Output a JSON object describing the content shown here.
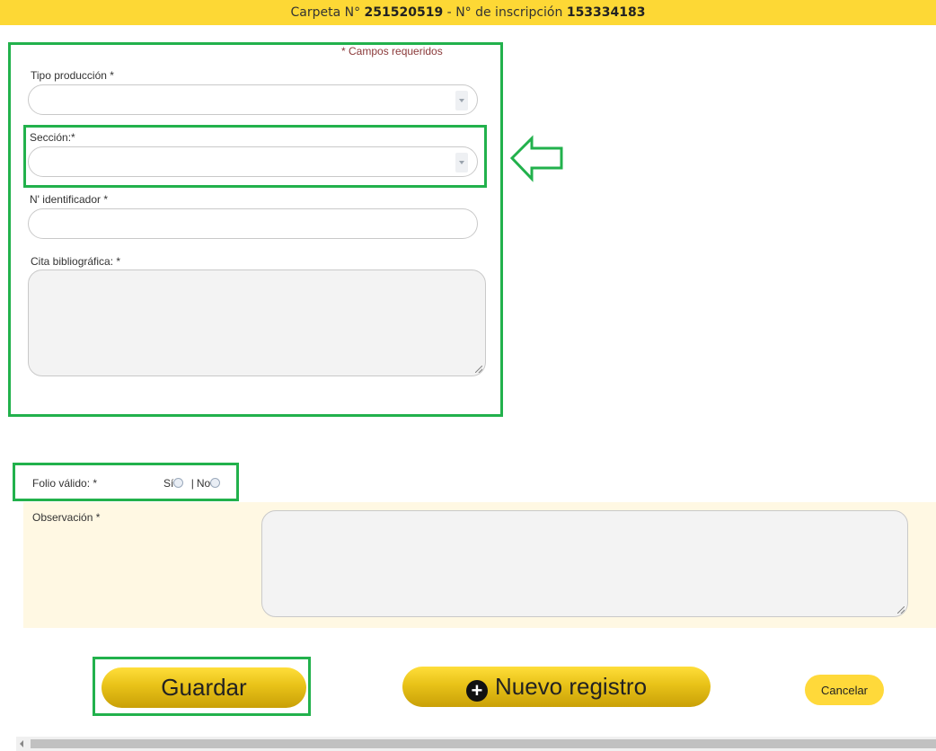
{
  "header": {
    "carpeta_label": "Carpeta N°",
    "carpeta_value": "251520519",
    "separator": "-",
    "inscripcion_label": "N° de inscripción",
    "inscripcion_value": "153334183"
  },
  "form": {
    "required_note": "* Campos requeridos",
    "tipo_produccion": {
      "label": "Tipo producción *",
      "value": ""
    },
    "seccion": {
      "label": "Sección:*",
      "value": ""
    },
    "identificador": {
      "label": "N' identificador *",
      "value": ""
    },
    "cita": {
      "label": "Cita bibliográfica: *",
      "value": ""
    }
  },
  "folio": {
    "label": "Folio válido: *",
    "yes_label": "Sí",
    "divider": "|",
    "no_label": "No"
  },
  "observacion": {
    "label": "Observación *",
    "value": ""
  },
  "actions": {
    "save_label": "Guardar",
    "new_label": "Nuevo registro",
    "cancel_label": "Cancelar"
  },
  "colors": {
    "accent_yellow": "#fdd835",
    "highlight_green": "#22b14c",
    "required_text": "#8b3a3a",
    "observation_bg": "#fff8e3"
  },
  "icons": [
    "chevron-down-icon",
    "plus-circle-icon",
    "arrow-left-icon",
    "resize-grip-icon"
  ]
}
